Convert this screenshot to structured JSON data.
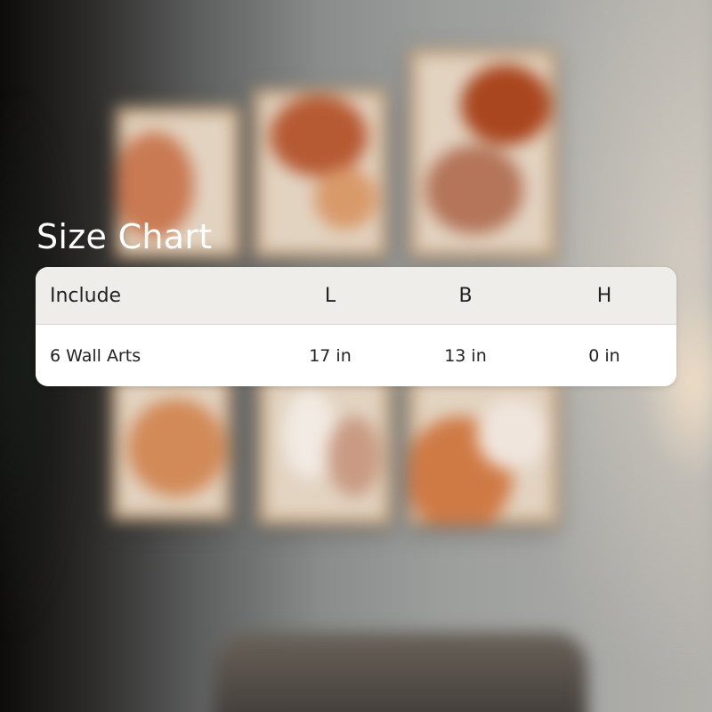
{
  "title": "Size Chart",
  "table": {
    "headers": [
      "Include",
      "L",
      "B",
      "H"
    ],
    "rows": [
      [
        "6 Wall Arts",
        "17 in",
        "13 in",
        "0 in"
      ]
    ]
  }
}
